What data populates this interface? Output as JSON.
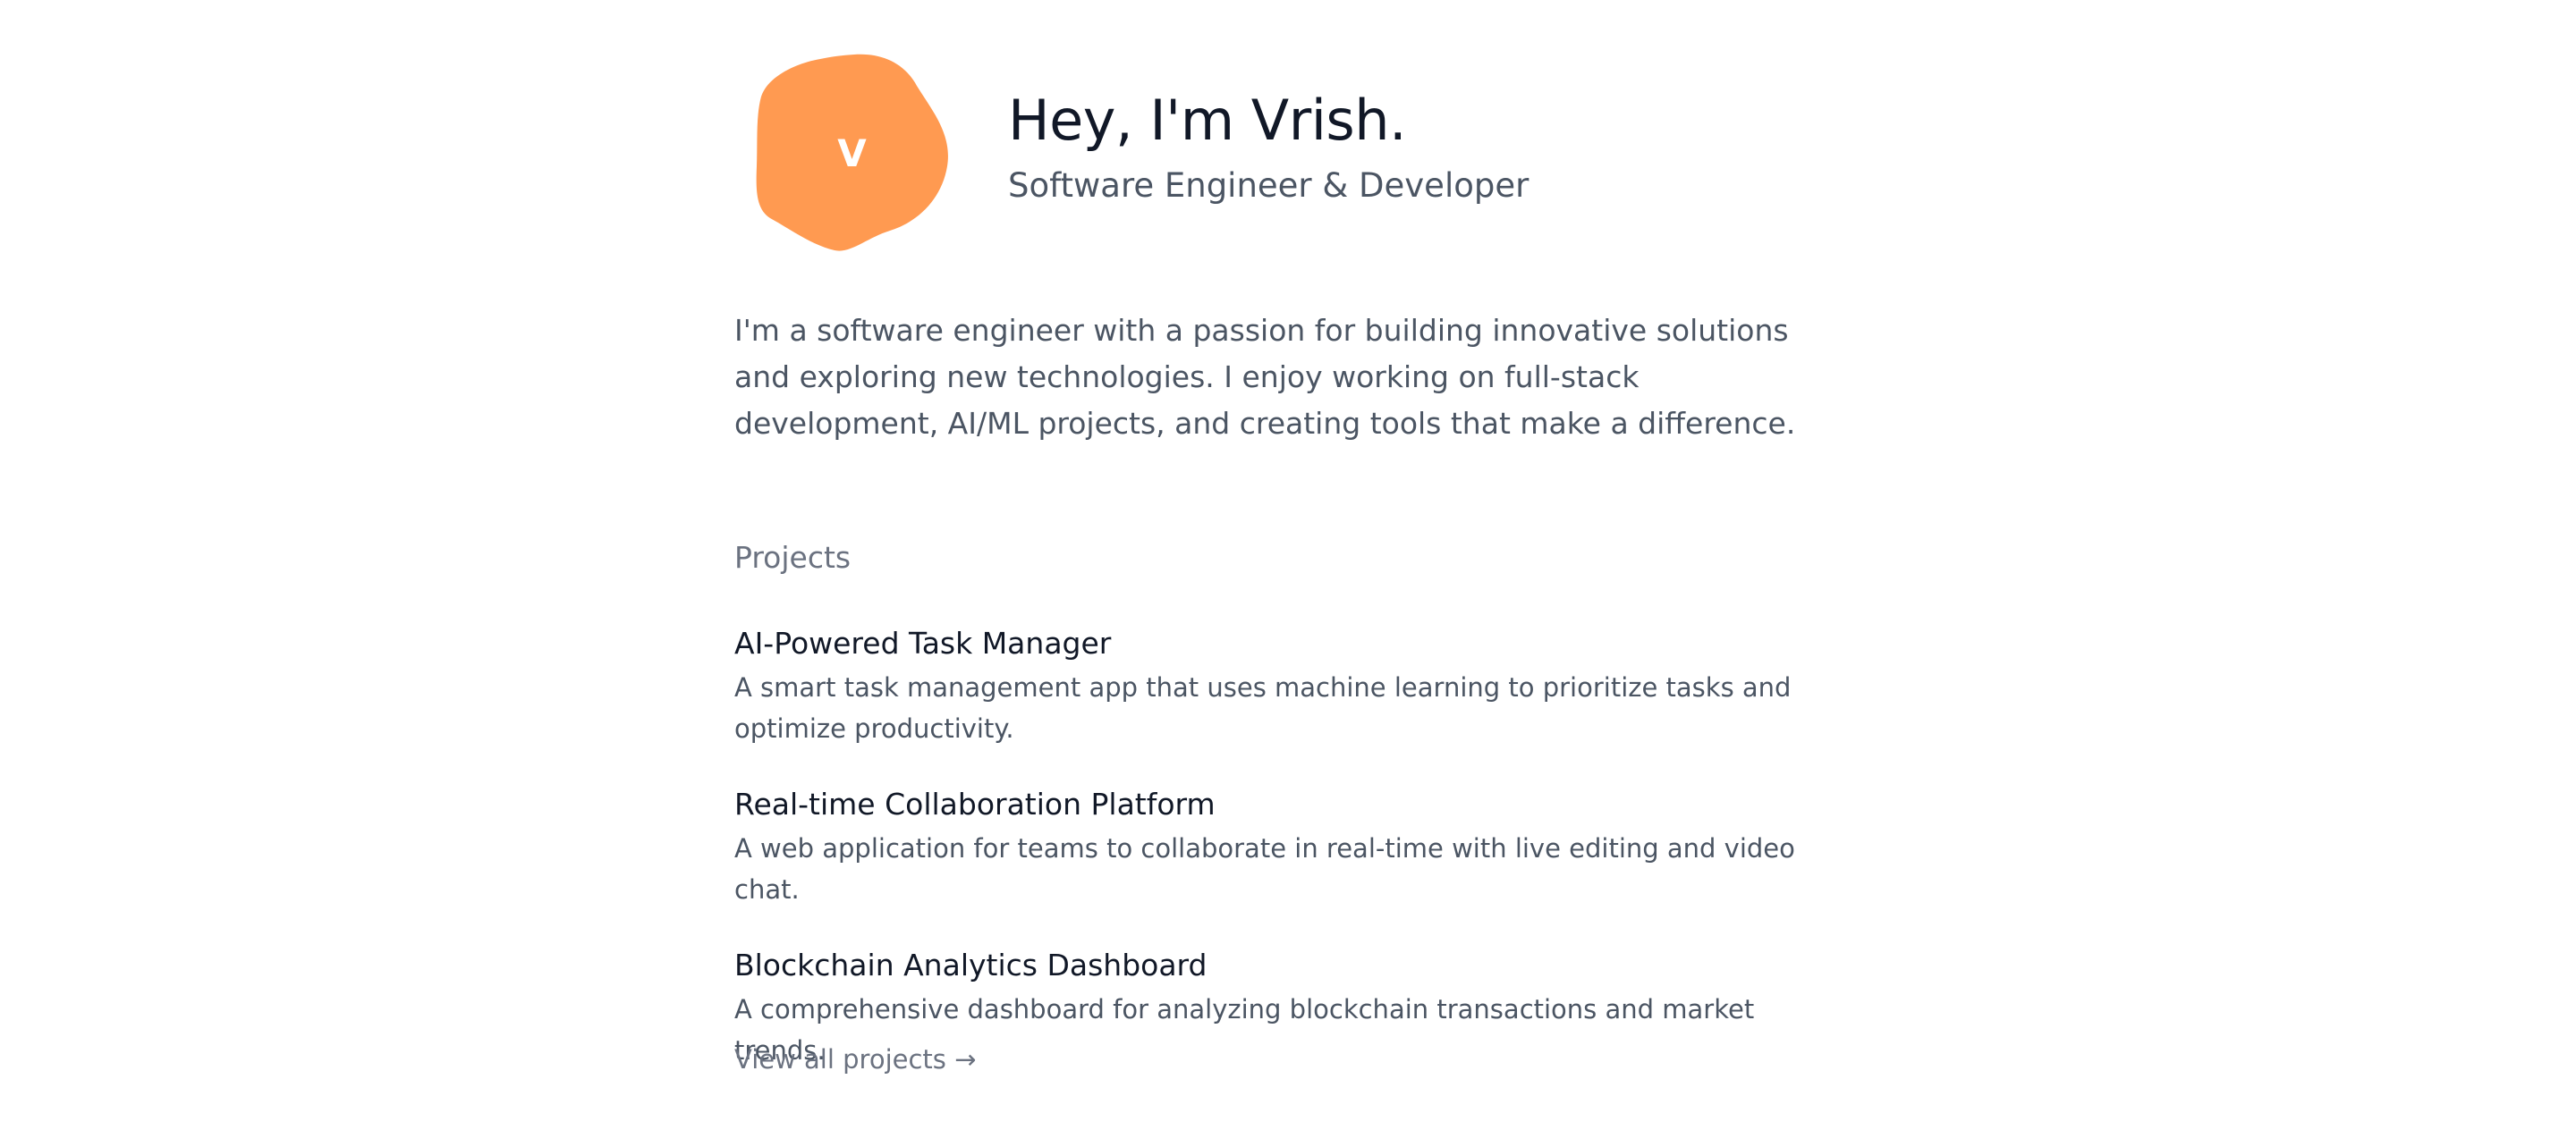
{
  "hero": {
    "avatar_letter": "V",
    "avatar_color": "#ff9a51",
    "title": "Hey, I'm Vrish.",
    "subtitle": "Software Engineer & Developer"
  },
  "bio": "I'm a software engineer with a passion for building innovative solutions and exploring new technologies. I enjoy working on full-stack development, AI/ML projects, and creating tools that make a difference.",
  "projects": {
    "heading": "Projects",
    "items": [
      {
        "title": "AI-Powered Task Manager",
        "description": "A smart task management app that uses machine learning to prioritize tasks and optimize productivity."
      },
      {
        "title": "Real-time Collaboration Platform",
        "description": "A web application for teams to collaborate in real-time with live editing and video chat."
      },
      {
        "title": "Blockchain Analytics Dashboard",
        "description": "A comprehensive dashboard for analyzing blockchain transactions and market trends."
      }
    ],
    "view_all_label": "View all projects →"
  },
  "colors": {
    "heading": "#111827",
    "body": "#4b5563",
    "muted": "#6b7280",
    "accent": "#ff9a51"
  }
}
